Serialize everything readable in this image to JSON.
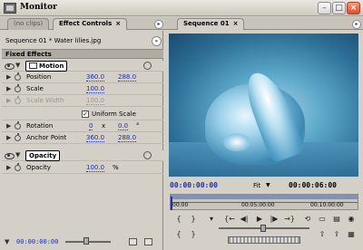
{
  "window": {
    "title": "Monitor"
  },
  "tabs": {
    "no_clips": "(no clips)",
    "effect_controls": "Effect Controls",
    "effect_close": "×",
    "sequence": "Sequence 01",
    "sequence_close": "×"
  },
  "effect_controls": {
    "clip_name": "Sequence 01 * Water lilies.jpg",
    "section_header": "Fixed Effects",
    "motion": {
      "label": "Motion",
      "position_label": "Position",
      "position_x": "360.0",
      "position_y": "288.0",
      "scale_label": "Scale",
      "scale_value": "100.0",
      "scale_width_label": "Scale Width",
      "scale_width_value": "100.0",
      "uniform_scale_label": "Uniform Scale",
      "uniform_scale_checked": true,
      "rotation_label": "Rotation",
      "rotation_turns": "0",
      "rotation_x": "x",
      "rotation_degrees": "0.0",
      "rotation_unit": "°",
      "anchor_label": "Anchor Point",
      "anchor_x": "360.0",
      "anchor_y": "288.0"
    },
    "opacity": {
      "label": "Opacity",
      "opacity_label": "Opacity",
      "opacity_value": "100.0",
      "opacity_unit": "%"
    },
    "timecode": "00:00:00:00"
  },
  "program": {
    "current_timecode": "00:00:00:00",
    "zoom": "Fit",
    "duration_timecode": "00:00:06:00",
    "ruler_labels": [
      "00:00",
      "00:05:00:00",
      "00:10:00:00"
    ]
  }
}
